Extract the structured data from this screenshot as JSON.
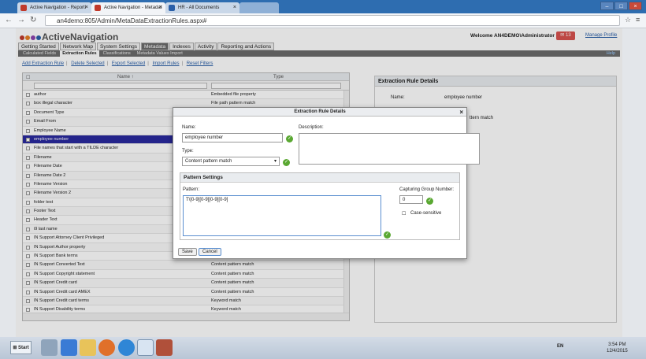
{
  "browser": {
    "tabs": [
      {
        "label": "Active Navigation - Reporti"
      },
      {
        "label": "Active Navigation - Metadat"
      },
      {
        "label": "HR - All Documents"
      }
    ],
    "url": "an4demo:805/Admin/MetaDataExtractionRules.aspx#"
  },
  "header": {
    "logo_text": "ActiveNavigation",
    "welcome": "Welcome AN4DEMO\\Administrator",
    "message_count": "13",
    "manage_profile": "Manage Profile"
  },
  "main_nav": [
    "Getting Started",
    "Network Map",
    "System Settings",
    "Metadata",
    "Indexes",
    "Activity",
    "Reporting and Actions"
  ],
  "sub_nav": [
    "Calculated Fields",
    "Extraction Rules",
    "Classifications",
    "Metadata Values Import"
  ],
  "help": "Help",
  "actions": [
    "Add Extraction Rule",
    "Delete Selected",
    "Export Selected",
    "Import Rules",
    "Reset Filters"
  ],
  "grid": {
    "col_name": "Name ↑",
    "col_type": "Type",
    "rows": [
      {
        "name": "author",
        "type": "Embedded file property"
      },
      {
        "name": "box illegal character",
        "type": "File path pattern match"
      },
      {
        "name": "Document Type",
        "type": ""
      },
      {
        "name": "Email From",
        "type": ""
      },
      {
        "name": "Employee Name",
        "type": ""
      },
      {
        "name": "employee number",
        "type": ""
      },
      {
        "name": "File names that start with a TILDE character",
        "type": ""
      },
      {
        "name": "Filename",
        "type": ""
      },
      {
        "name": "Filename Date",
        "type": ""
      },
      {
        "name": "Filename Date 2",
        "type": ""
      },
      {
        "name": "Filename Version",
        "type": ""
      },
      {
        "name": "Filename Version 2",
        "type": ""
      },
      {
        "name": "folder test",
        "type": ""
      },
      {
        "name": "Footer Text",
        "type": ""
      },
      {
        "name": "Header Text",
        "type": ""
      },
      {
        "name": "i9 last name",
        "type": ""
      },
      {
        "name": "IN Support Attorney Client Privileged",
        "type": ""
      },
      {
        "name": "IN Support Author property",
        "type": ""
      },
      {
        "name": "IN Support Bank terms",
        "type": ""
      },
      {
        "name": "IN Support Converted Text",
        "type": "Content pattern match"
      },
      {
        "name": "IN Support Copyright statement",
        "type": "Content pattern match"
      },
      {
        "name": "IN Support Credit card",
        "type": "Content pattern match"
      },
      {
        "name": "IN Support Credit card AMEX",
        "type": "Content pattern match"
      },
      {
        "name": "IN Support Credit card terms",
        "type": "Keyword match"
      },
      {
        "name": "IN Support Disability terms",
        "type": "Keyword match"
      },
      {
        "name": "IN Support Driving licence terms",
        "type": "Keyword match"
      }
    ]
  },
  "details_panel": {
    "title": "Extraction Rule Details",
    "name_label": "Name:",
    "name_value": "employee number",
    "type_partial": "ttern match"
  },
  "modal": {
    "title": "Extraction Rule Details",
    "name_label": "Name:",
    "name_value": "employee number",
    "desc_label": "Description:",
    "type_label": "Type:",
    "type_value": "Content pattern match",
    "pattern_settings": "Pattern Settings",
    "pattern_label": "Pattern:",
    "pattern_value": "T\\[0-9][0-9][0-9][0-9]",
    "capture_label": "Capturing Group Number:",
    "capture_value": "0",
    "case_label": "Case-sensitive",
    "save": "Save",
    "cancel": "Cancel"
  },
  "taskbar": {
    "start": "Start",
    "lang": "EN",
    "time": "3:54 PM",
    "date": "12/4/2015"
  },
  "colors": {
    "accent": "#2a2a9f",
    "ok": "#5aa832",
    "badge": "#d9534f",
    "logo_dots": [
      "#c0392b",
      "#e67e22",
      "#8e44ad",
      "#2a5fa8"
    ]
  }
}
